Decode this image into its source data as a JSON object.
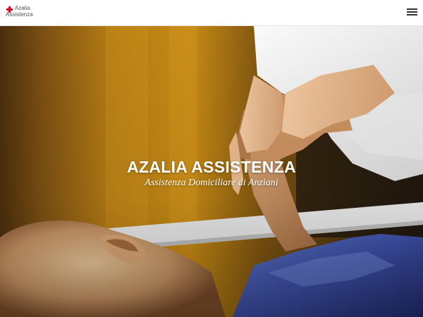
{
  "header": {
    "logo": {
      "line1": "Azalia",
      "line2": "Assistenza"
    }
  },
  "hero": {
    "title": "AZALIA ASSISTENZA",
    "subtitle": "Assistenza Domiciliare di Anziani"
  },
  "colors": {
    "brand_red": "#e2001a",
    "hero_text": "#ffffff",
    "header_bg": "#ffffff"
  }
}
